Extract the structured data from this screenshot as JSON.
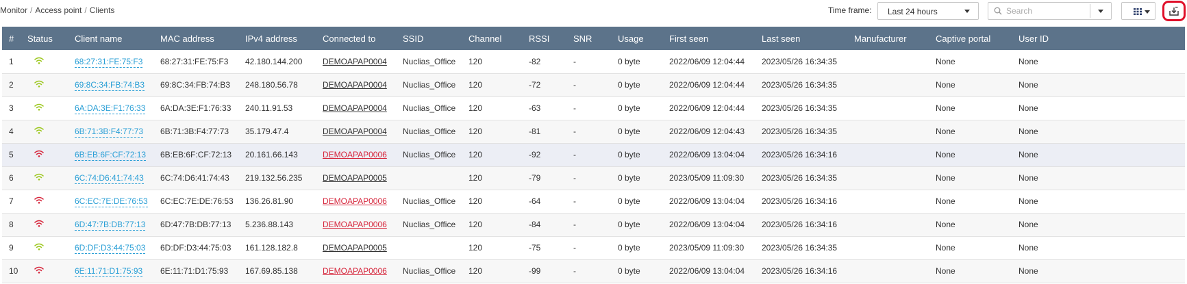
{
  "breadcrumb": [
    "Monitor",
    "Access point",
    "Clients"
  ],
  "toolbar": {
    "timeframe_label": "Time frame:",
    "timeframe_value": "Last 24 hours",
    "search_placeholder": "Search"
  },
  "colors": {
    "header_bg": "#5c738a",
    "link": "#2a9fd6",
    "status_ok": "#9cc71e",
    "status_bad": "#d6253b",
    "export_highlight": "#e0102a"
  },
  "table": {
    "columns": [
      "#",
      "Status",
      "Client name",
      "MAC address",
      "IPv4 address",
      "Connected to",
      "SSID",
      "Channel",
      "RSSI",
      "SNR",
      "Usage",
      "First seen",
      "Last seen",
      "Manufacturer",
      "Captive portal",
      "User ID"
    ],
    "rows": [
      {
        "num": "1",
        "status": "good",
        "client": "68:27:31:FE:75:F3",
        "mac": "68:27:31:FE:75:F3",
        "ip": "42.180.144.200",
        "ap": "DEMOAPAP0004",
        "ssid": "Nuclias_Office",
        "channel": "120",
        "rssi": "-82",
        "snr": "-",
        "usage": "0 byte",
        "first": "2022/06/09 12:04:44",
        "last": "2023/05/26 16:34:35",
        "manufacturer": "",
        "portal": "None",
        "user": "None"
      },
      {
        "num": "2",
        "status": "good",
        "client": "69:8C:34:FB:74:B3",
        "mac": "69:8C:34:FB:74:B3",
        "ip": "248.180.56.78",
        "ap": "DEMOAPAP0004",
        "ssid": "Nuclias_Office",
        "channel": "120",
        "rssi": "-72",
        "snr": "-",
        "usage": "0 byte",
        "first": "2022/06/09 12:04:44",
        "last": "2023/05/26 16:34:35",
        "manufacturer": "",
        "portal": "None",
        "user": "None"
      },
      {
        "num": "3",
        "status": "good",
        "client": "6A:DA:3E:F1:76:33",
        "mac": "6A:DA:3E:F1:76:33",
        "ip": "240.11.91.53",
        "ap": "DEMOAPAP0004",
        "ssid": "Nuclias_Office",
        "channel": "120",
        "rssi": "-63",
        "snr": "-",
        "usage": "0 byte",
        "first": "2022/06/09 12:04:44",
        "last": "2023/05/26 16:34:35",
        "manufacturer": "",
        "portal": "None",
        "user": "None"
      },
      {
        "num": "4",
        "status": "good",
        "client": "6B:71:3B:F4:77:73",
        "mac": "6B:71:3B:F4:77:73",
        "ip": "35.179.47.4",
        "ap": "DEMOAPAP0004",
        "ssid": "Nuclias_Office",
        "channel": "120",
        "rssi": "-81",
        "snr": "-",
        "usage": "0 byte",
        "first": "2022/06/09 12:04:43",
        "last": "2023/05/26 16:34:35",
        "manufacturer": "",
        "portal": "None",
        "user": "None"
      },
      {
        "num": "5",
        "status": "bad",
        "client": "6B:EB:6F:CF:72:13",
        "mac": "6B:EB:6F:CF:72:13",
        "ip": "20.161.66.143",
        "ap": "DEMOAPAP0006",
        "ssid": "Nuclias_Office",
        "channel": "120",
        "rssi": "-92",
        "snr": "-",
        "usage": "0 byte",
        "first": "2022/06/09 13:04:04",
        "last": "2023/05/26 16:34:16",
        "manufacturer": "",
        "portal": "None",
        "user": "None"
      },
      {
        "num": "6",
        "status": "good",
        "client": "6C:74:D6:41:74:43",
        "mac": "6C:74:D6:41:74:43",
        "ip": "219.132.56.235",
        "ap": "DEMOAPAP0005",
        "ssid": "",
        "channel": "120",
        "rssi": "-79",
        "snr": "-",
        "usage": "0 byte",
        "first": "2023/05/09 11:09:30",
        "last": "2023/05/26 16:34:35",
        "manufacturer": "",
        "portal": "None",
        "user": "None"
      },
      {
        "num": "7",
        "status": "bad",
        "client": "6C:EC:7E:DE:76:53",
        "mac": "6C:EC:7E:DE:76:53",
        "ip": "136.26.81.90",
        "ap": "DEMOAPAP0006",
        "ssid": "Nuclias_Office",
        "channel": "120",
        "rssi": "-64",
        "snr": "-",
        "usage": "0 byte",
        "first": "2022/06/09 13:04:04",
        "last": "2023/05/26 16:34:16",
        "manufacturer": "",
        "portal": "None",
        "user": "None"
      },
      {
        "num": "8",
        "status": "bad",
        "client": "6D:47:7B:DB:77:13",
        "mac": "6D:47:7B:DB:77:13",
        "ip": "5.236.88.143",
        "ap": "DEMOAPAP0006",
        "ssid": "Nuclias_Office",
        "channel": "120",
        "rssi": "-84",
        "snr": "-",
        "usage": "0 byte",
        "first": "2022/06/09 13:04:04",
        "last": "2023/05/26 16:34:16",
        "manufacturer": "",
        "portal": "None",
        "user": "None"
      },
      {
        "num": "9",
        "status": "good",
        "client": "6D:DF:D3:44:75:03",
        "mac": "6D:DF:D3:44:75:03",
        "ip": "161.128.182.8",
        "ap": "DEMOAPAP0005",
        "ssid": "",
        "channel": "120",
        "rssi": "-75",
        "snr": "-",
        "usage": "0 byte",
        "first": "2023/05/09 11:09:30",
        "last": "2023/05/26 16:34:35",
        "manufacturer": "",
        "portal": "None",
        "user": "None"
      },
      {
        "num": "10",
        "status": "bad",
        "client": "6E:11:71:D1:75:93",
        "mac": "6E:11:71:D1:75:93",
        "ip": "167.69.85.138",
        "ap": "DEMOAPAP0006",
        "ssid": "Nuclias_Office",
        "channel": "120",
        "rssi": "-99",
        "snr": "-",
        "usage": "0 byte",
        "first": "2022/06/09 13:04:04",
        "last": "2023/05/26 16:34:16",
        "manufacturer": "",
        "portal": "None",
        "user": "None"
      }
    ]
  }
}
